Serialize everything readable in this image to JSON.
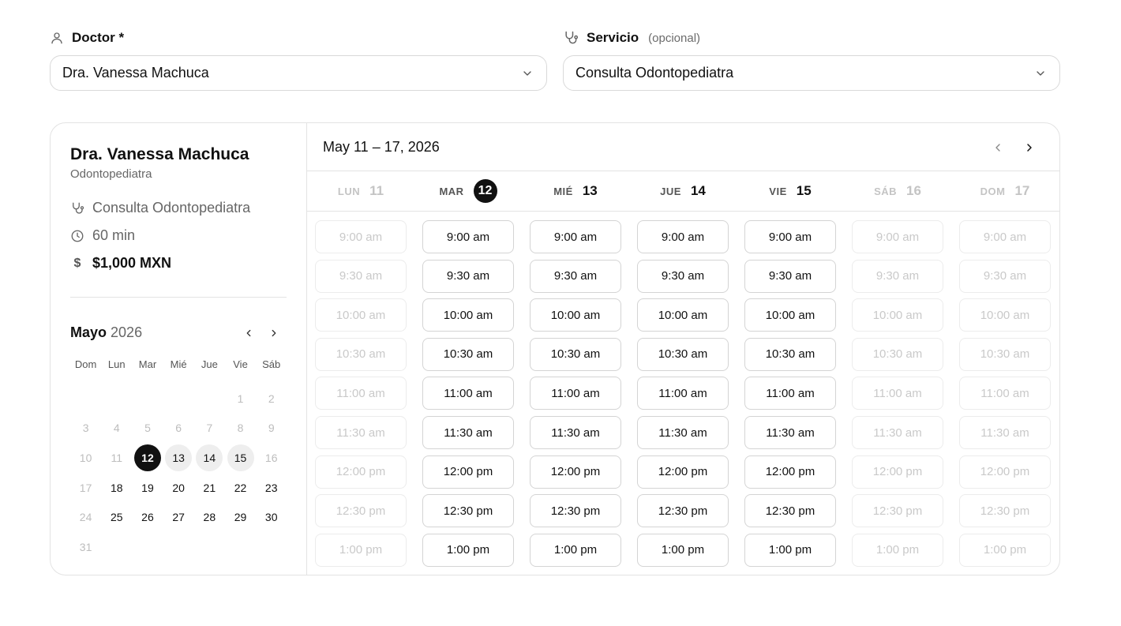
{
  "doctor_field": {
    "label": "Doctor *",
    "value": "Dra. Vanessa Machuca"
  },
  "service_field": {
    "label": "Servicio",
    "optional": "(opcional)",
    "value": "Consulta Odontopediatra"
  },
  "profile": {
    "name": "Dra. Vanessa Machuca",
    "specialty": "Odontopediatra",
    "service": "Consulta Odontopediatra",
    "duration": "60 min",
    "currency_symbol": "$",
    "price": "$1,000 MXN"
  },
  "mini_calendar": {
    "month": "Mayo",
    "year": "2026",
    "weekdays": [
      "Dom",
      "Lun",
      "Mar",
      "Mié",
      "Jue",
      "Vie",
      "Sáb"
    ],
    "leading_blanks": 5,
    "days": [
      {
        "d": "1",
        "s": "dis"
      },
      {
        "d": "2",
        "s": "dis"
      },
      {
        "d": "3",
        "s": "dis"
      },
      {
        "d": "4",
        "s": "dis"
      },
      {
        "d": "5",
        "s": "dis"
      },
      {
        "d": "6",
        "s": "dis"
      },
      {
        "d": "7",
        "s": "dis"
      },
      {
        "d": "8",
        "s": "dis"
      },
      {
        "d": "9",
        "s": "dis"
      },
      {
        "d": "10",
        "s": "dis"
      },
      {
        "d": "11",
        "s": "dis"
      },
      {
        "d": "12",
        "s": "sel"
      },
      {
        "d": "13",
        "s": "wk"
      },
      {
        "d": "14",
        "s": "wk"
      },
      {
        "d": "15",
        "s": "wk"
      },
      {
        "d": "16",
        "s": "dis"
      },
      {
        "d": "17",
        "s": "dis"
      },
      {
        "d": "18",
        "s": "avail"
      },
      {
        "d": "19",
        "s": "avail"
      },
      {
        "d": "20",
        "s": "avail"
      },
      {
        "d": "21",
        "s": "avail"
      },
      {
        "d": "22",
        "s": "avail"
      },
      {
        "d": "23",
        "s": "avail"
      },
      {
        "d": "24",
        "s": "dis"
      },
      {
        "d": "25",
        "s": "avail"
      },
      {
        "d": "26",
        "s": "avail"
      },
      {
        "d": "27",
        "s": "avail"
      },
      {
        "d": "28",
        "s": "avail"
      },
      {
        "d": "29",
        "s": "avail"
      },
      {
        "d": "30",
        "s": "avail"
      },
      {
        "d": "31",
        "s": "dis"
      }
    ]
  },
  "week": {
    "title": "May 11 – 17, 2026",
    "days": [
      {
        "name": "LUN",
        "date": "11",
        "enabled": false,
        "today": false
      },
      {
        "name": "MAR",
        "date": "12",
        "enabled": true,
        "today": true
      },
      {
        "name": "MIÉ",
        "date": "13",
        "enabled": true,
        "today": false
      },
      {
        "name": "JUE",
        "date": "14",
        "enabled": true,
        "today": false
      },
      {
        "name": "VIE",
        "date": "15",
        "enabled": true,
        "today": false
      },
      {
        "name": "SÁB",
        "date": "16",
        "enabled": false,
        "today": false
      },
      {
        "name": "DOM",
        "date": "17",
        "enabled": false,
        "today": false
      }
    ],
    "times": [
      "9:00 am",
      "9:30 am",
      "10:00 am",
      "10:30 am",
      "11:00 am",
      "11:30 am",
      "12:00 pm",
      "12:30 pm",
      "1:00 pm"
    ]
  },
  "colors": {
    "text": "#111111",
    "muted": "#666666",
    "border": "#e3e3e3",
    "disabled": "#c9c9c9",
    "selected": "#111111"
  },
  "icons": {
    "doctor": "user-icon",
    "service": "stethoscope-icon",
    "duration": "clock-icon",
    "dropdown": "chevron-down-icon",
    "prev": "chevron-left-icon",
    "next": "chevron-right-icon"
  }
}
